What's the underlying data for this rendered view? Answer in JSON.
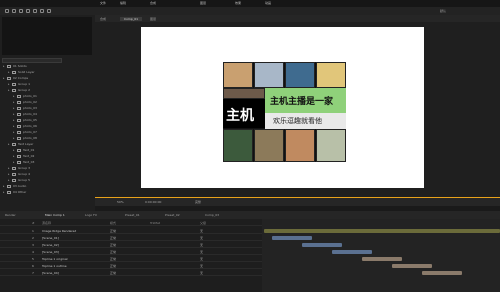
{
  "menu": {
    "items": [
      "文件",
      "编辑",
      "合成",
      "图层",
      "效果",
      "动画",
      "视图",
      "窗口",
      "帮助"
    ]
  },
  "toolbar": {
    "workspace": "默认",
    "comp_name": "Comp_01"
  },
  "comp_tabs": [
    "合成",
    "Comp_01",
    "图层"
  ],
  "project": {
    "search_placeholder": "",
    "items": [
      {
        "label": "01 Solids",
        "indent": 0
      },
      {
        "label": "Solid Layer",
        "indent": 1
      },
      {
        "label": "02 Comps",
        "indent": 0
      },
      {
        "label": "Group 1",
        "indent": 1
      },
      {
        "label": "Group 2",
        "indent": 1
      },
      {
        "label": "photo_01",
        "indent": 2
      },
      {
        "label": "photo_02",
        "indent": 2
      },
      {
        "label": "photo_03",
        "indent": 2
      },
      {
        "label": "photo_04",
        "indent": 2
      },
      {
        "label": "photo_05",
        "indent": 2
      },
      {
        "label": "photo_06",
        "indent": 2
      },
      {
        "label": "photo_07",
        "indent": 2
      },
      {
        "label": "photo_08",
        "indent": 2
      },
      {
        "label": "Text Layer",
        "indent": 1
      },
      {
        "label": "Text_01",
        "indent": 2
      },
      {
        "label": "Text_02",
        "indent": 2
      },
      {
        "label": "Text_03",
        "indent": 2
      },
      {
        "label": "Group 3",
        "indent": 1
      },
      {
        "label": "Group 4",
        "indent": 1
      },
      {
        "label": "Group 5",
        "indent": 1
      },
      {
        "label": "03 Audio",
        "indent": 0
      },
      {
        "label": "04 Other",
        "indent": 0
      }
    ]
  },
  "viewer": {
    "banner_black_text": "主机",
    "banner_green_text": "主机主播是一家",
    "banner_light_text": "欢乐逗趣就看他"
  },
  "viewer_bar": {
    "zoom": "50%",
    "time": "0:00:00:00",
    "quality": "完整"
  },
  "bottom_tabs": [
    "Render",
    "Main Comp 1",
    "Logo FX",
    "Preset_01",
    "Preset_02",
    "Comp_03"
  ],
  "timeline": {
    "headers": [
      "#",
      "源名称",
      "模式",
      "TrkMat",
      "父级"
    ],
    "layers": [
      {
        "num": "1",
        "name": "Image Ridge Rendered",
        "mode": "正常",
        "parent": "无"
      },
      {
        "num": "2",
        "name": "[Scene_01]",
        "mode": "正常",
        "parent": "无"
      },
      {
        "num": "3",
        "name": "[Scene_02]",
        "mode": "正常",
        "parent": "无"
      },
      {
        "num": "4",
        "name": "[Scene_03]",
        "mode": "正常",
        "parent": "无"
      },
      {
        "num": "5",
        "name": "Topline 1 original",
        "mode": "正常",
        "parent": "无"
      },
      {
        "num": "6",
        "name": "Topline 1 outline",
        "mode": "正常",
        "parent": "无"
      },
      {
        "num": "7",
        "name": "[Scene_04]",
        "mode": "正常",
        "parent": "无"
      }
    ]
  }
}
